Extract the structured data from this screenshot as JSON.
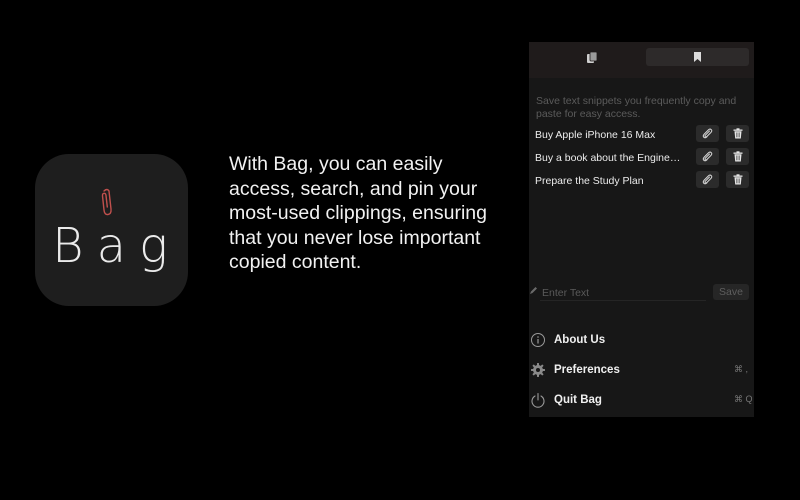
{
  "app_icon": {
    "logo_text": "Bag",
    "icon": "paperclip-icon",
    "accent": "#c0504d"
  },
  "tagline": "With Bag, you can easily access, search, and pin your most-used clippings, ensuring that you never lose important copied content.",
  "panel": {
    "tabs": [
      {
        "icon": "clipboard-icon"
      },
      {
        "icon": "bookmark-icon",
        "selected": true
      }
    ],
    "hint": "Save text snippets you frequently copy and paste for easy access.",
    "snippets": [
      {
        "text": "Buy Apple iPhone 16 Max"
      },
      {
        "text": "Buy a book about the Engineering"
      },
      {
        "text": "Prepare the Study Plan"
      }
    ],
    "entry": {
      "placeholder": "Enter Text",
      "save_label": "Save"
    },
    "menu": [
      {
        "label": "About Us",
        "icon": "info-icon",
        "shortcut": ""
      },
      {
        "label": "Preferences",
        "icon": "gear-icon",
        "shortcut": "⌘ ,"
      },
      {
        "label": "Quit Bag",
        "icon": "power-icon",
        "shortcut": "⌘ Q"
      }
    ]
  }
}
